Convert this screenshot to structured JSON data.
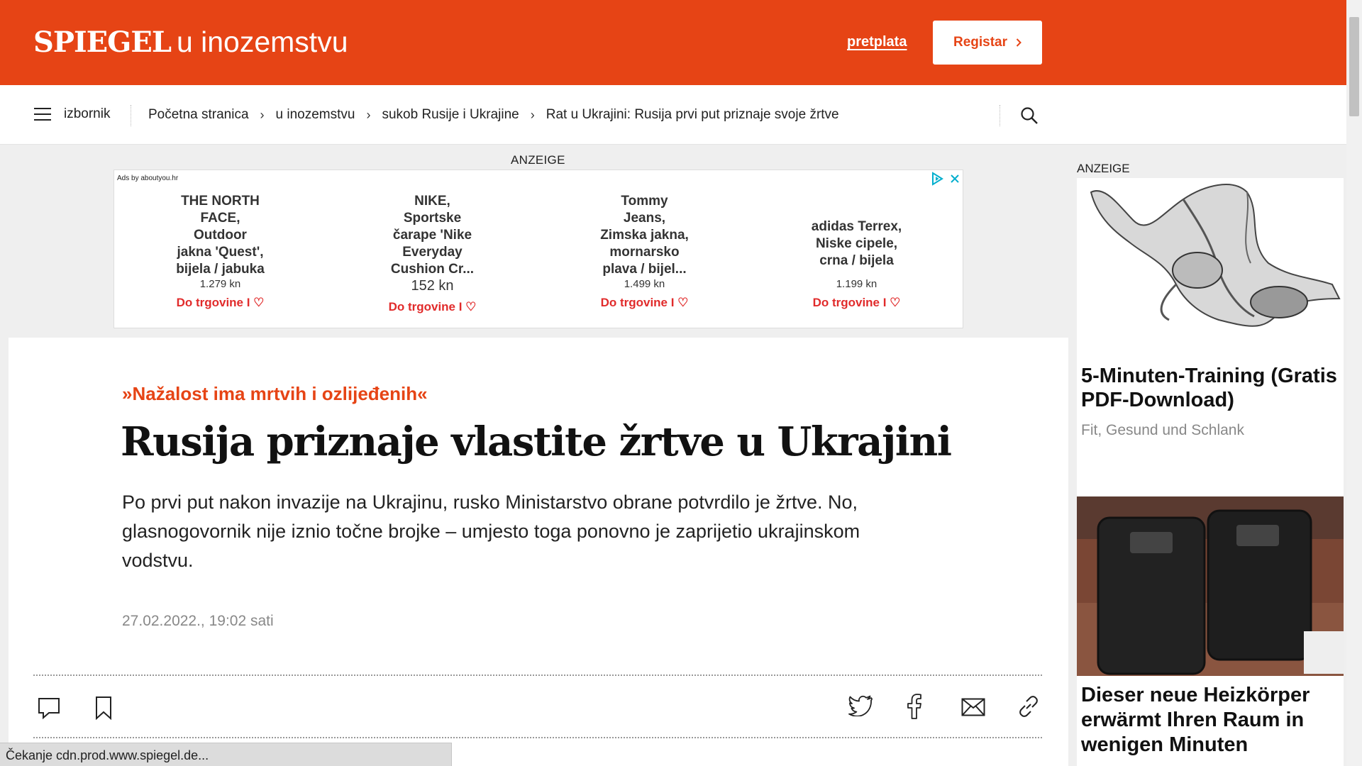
{
  "header": {
    "brand": "SPIEGEL",
    "section": "u inozemstvu",
    "subscribe_link": "pretplata",
    "register_button": "Registar"
  },
  "nav": {
    "menu_label": "izbornik",
    "breadcrumbs": [
      "Početna stranica",
      "u inozemstvu",
      "sukob Rusije i Ukrajine",
      "Rat u Ukrajini: Rusija prvi put priznaje svoje žrtve"
    ]
  },
  "top_ad": {
    "label": "ANZEIGE",
    "ads_by": "Ads by aboutyou.hr",
    "items": [
      {
        "name": "THE NORTH\nFACE,\nOutdoor\njakna 'Quest',\nbijela / jabuka",
        "price": "1.279 kn",
        "cta": "Do trgovine I ♡"
      },
      {
        "name": "NIKE,\nSportske\nčarape 'Nike\nEveryday\nCushion Cr...",
        "price": "152 kn",
        "cta": "Do trgovine I ♡"
      },
      {
        "name": "Tommy\nJeans,\nZimska jakna,\nmornarsko\nplava / bijel...",
        "price": "1.499 kn",
        "cta": "Do trgovine I ♡"
      },
      {
        "name": "adidas Terrex,\nNiske cipele,\ncrna / bijela",
        "price": "1.199 kn",
        "cta": "Do trgovine I ♡"
      }
    ]
  },
  "article": {
    "kicker": "»Nažalost ima mrtvih i ozlijeđenih«",
    "headline": "Rusija priznaje vlastite žrtve u Ukrajini",
    "lead": "Po prvi put nakon invazije na Ukrajinu, rusko Ministarstvo obrane potvrdilo je žrtve. No, glasnogovornik nije iznio točne brojke – umjesto toga ponovno je zaprijetio ukrajinskom vodstvu.",
    "date": "27.02.2022., 19:02 sati"
  },
  "side_ad": {
    "label": "ANZEIGE",
    "title1": "5-Minuten-Training (Gratis PDF-Download)",
    "subtitle1": "Fit, Gesund und Schlank",
    "title2": "Dieser neue Heizkörper erwärmt Ihren Raum in wenigen Minuten"
  },
  "status": {
    "text": "Čekanje cdn.prod.www.spiegel.de..."
  },
  "colors": {
    "brand_red": "#e64415",
    "cta_red": "#e12b2b",
    "ad_blue": "#00aecd"
  }
}
